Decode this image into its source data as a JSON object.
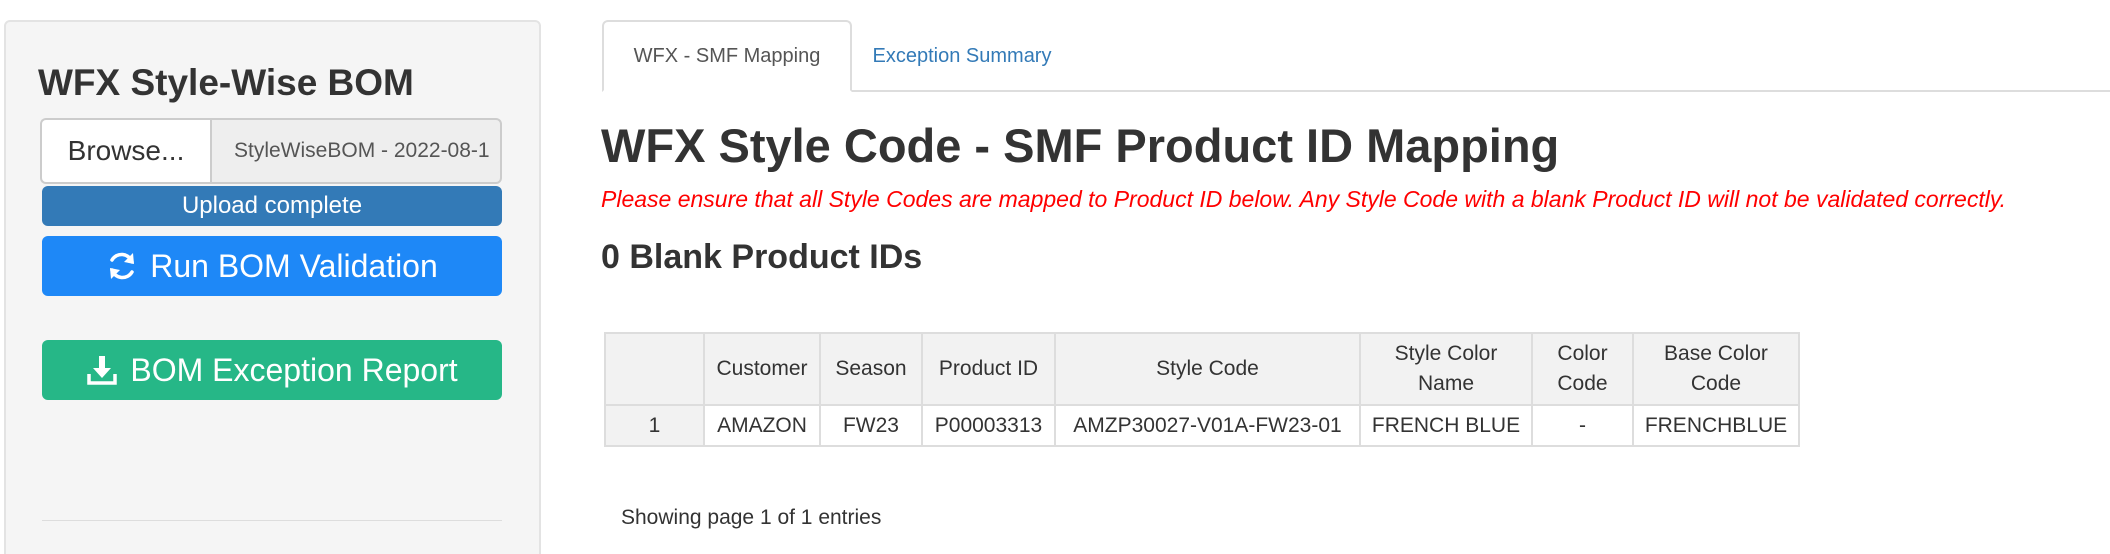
{
  "sidebar": {
    "title": "WFX Style-Wise BOM",
    "file_input": {
      "browse_label": "Browse...",
      "file_name": "StyleWiseBOM - 2022-08-1"
    },
    "upload_status": "Upload complete",
    "run_button": {
      "label": "Run BOM Validation",
      "icon": "refresh-icon"
    },
    "report_button": {
      "label": "BOM Exception Report",
      "icon": "download-icon"
    }
  },
  "tabs": [
    {
      "label": "WFX - SMF Mapping",
      "active": true
    },
    {
      "label": "Exception Summary",
      "active": false
    }
  ],
  "main": {
    "title": "WFX Style Code - SMF Product ID Mapping",
    "warning": "Please ensure that all Style Codes are mapped to Product ID below. Any Style Code with a blank Product ID will not be validated correctly.",
    "blank_count": "0 Blank Product IDs",
    "table": {
      "headers": [
        "",
        "Customer",
        "Season",
        "Product ID",
        "Style Code",
        "Style Color Name",
        "Color Code",
        "Base Color Code"
      ],
      "rows": [
        [
          "1",
          "AMAZON",
          "FW23",
          "P00003313",
          "AMZP30027-V01A-FW23-01",
          "FRENCH BLUE",
          "-",
          "FRENCHBLUE"
        ]
      ]
    },
    "pager": "Showing page 1 of 1 entries"
  },
  "colors": {
    "progress": "#337ab7",
    "run_button": "#1e88f7",
    "report_button": "#26b787",
    "warning_text": "#ff0000",
    "tab_link": "#337ab7"
  }
}
